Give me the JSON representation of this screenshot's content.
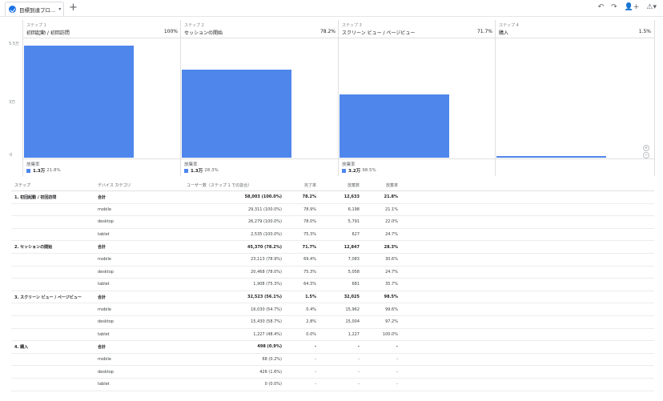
{
  "tab": {
    "label": "目標到達プロ...",
    "icon": "check-circle-icon",
    "caret": "▾"
  },
  "add_tab": "+",
  "toolbar": [
    "undo-icon",
    "redo-icon",
    "share-user-icon",
    "warning-icon"
  ],
  "chart_data": {
    "type": "bar",
    "y_ticks": [
      "5.5万",
      "3万",
      "0"
    ],
    "categories": [
      "初回起動 / 初回訪問",
      "セッションの開始",
      "スクリーン ビュー / ページビュー",
      "購入"
    ],
    "step_labels": [
      "ステップ 1",
      "ステップ 2",
      "ステップ 3",
      "ステップ 4"
    ],
    "step_pcts": [
      "100%",
      "78.2%",
      "71.7%",
      "1.5%"
    ],
    "values": [
      58003,
      45370,
      32523,
      498
    ],
    "ylim": [
      0,
      60000
    ],
    "dropoff_label": "放棄率",
    "dropoffs": [
      {
        "count": "1.3万",
        "pct": "21.8%"
      },
      {
        "count": "1.3万",
        "pct": "28.3%"
      },
      {
        "count": "3.2万",
        "pct": "98.5%"
      }
    ],
    "bar_color": "#4f86ec"
  },
  "table": {
    "headers": [
      "ステップ",
      "デバイス カテゴリ",
      "ユーザー数（ステップ 1 での割合）",
      "完了率",
      "放棄数",
      "放棄率"
    ],
    "rows": [
      [
        "1. 初回起動 / 初回訪問",
        "合計",
        "58,003 (100.0%)",
        "78.2%",
        "12,633",
        "21.8%"
      ],
      [
        "",
        "mobile",
        "29,311 (100.0%)",
        "78.9%",
        "6,198",
        "21.1%"
      ],
      [
        "",
        "desktop",
        "26,279 (100.0%)",
        "78.0%",
        "5,791",
        "22.0%"
      ],
      [
        "",
        "tablet",
        "2,535 (100.0%)",
        "75.3%",
        "627",
        "24.7%"
      ],
      [
        "2. セッションの開始",
        "合計",
        "45,370 (78.2%)",
        "71.7%",
        "12,847",
        "28.3%"
      ],
      [
        "",
        "mobile",
        "23,113 (78.9%)",
        "69.4%",
        "7,083",
        "30.6%"
      ],
      [
        "",
        "desktop",
        "20,468 (78.0%)",
        "75.3%",
        "5,058",
        "24.7%"
      ],
      [
        "",
        "tablet",
        "1,908 (75.3%)",
        "64.3%",
        "681",
        "35.7%"
      ],
      [
        "3. スクリーン ビュー / ページビュー",
        "合計",
        "32,523 (56.1%)",
        "1.5%",
        "32,025",
        "98.5%"
      ],
      [
        "",
        "mobile",
        "16,030 (54.7%)",
        "0.4%",
        "15,962",
        "99.6%"
      ],
      [
        "",
        "desktop",
        "15,430 (58.7%)",
        "2.8%",
        "15,004",
        "97.2%"
      ],
      [
        "",
        "tablet",
        "1,227 (48.4%)",
        "0.0%",
        "1,227",
        "100.0%"
      ],
      [
        "4. 購入",
        "合計",
        "498 (0.9%)",
        "-",
        "-",
        "-"
      ],
      [
        "",
        "mobile",
        "68 (0.2%)",
        "-",
        "-",
        "-"
      ],
      [
        "",
        "desktop",
        "426 (1.6%)",
        "-",
        "-",
        "-"
      ],
      [
        "",
        "tablet",
        "0 (0.0%)",
        "-",
        "-",
        "-"
      ]
    ]
  }
}
